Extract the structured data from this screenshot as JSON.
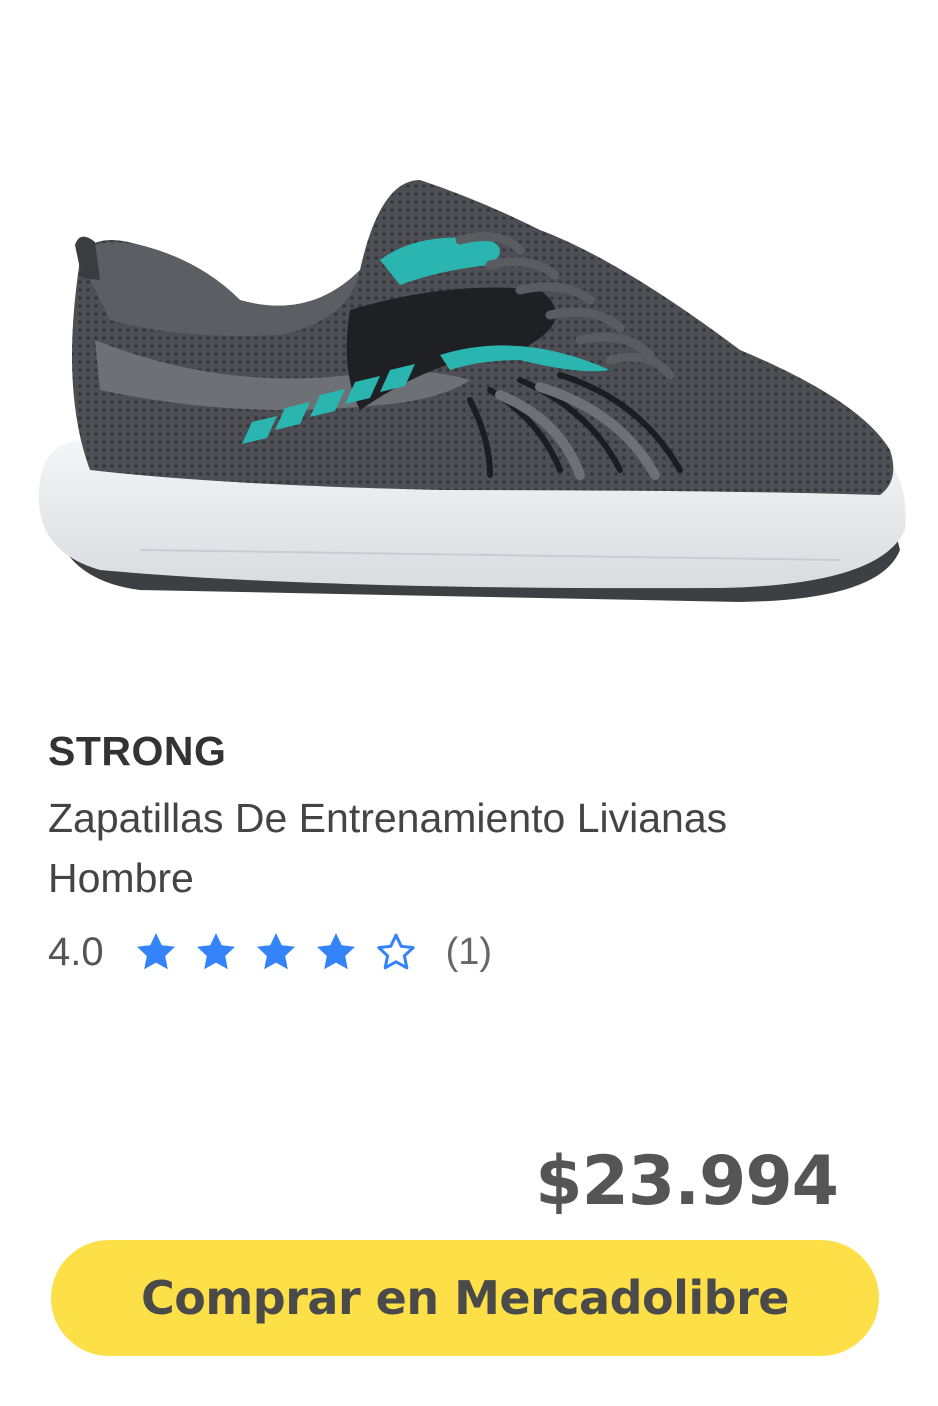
{
  "product": {
    "brand": "STRONG",
    "title": "Zapatillas De Entrenamiento Livianas Hombre",
    "image_alt": "sneaker-image",
    "rating": {
      "value": "4.0",
      "stars_filled": 4,
      "stars_total": 5,
      "count": "(1)"
    },
    "price": "$23.994"
  },
  "cta": {
    "label": "Comprar en Mercadolibre"
  },
  "colors": {
    "star": "#3483fa",
    "button_bg": "#fde047",
    "button_text": "#4a4a4a",
    "shoe_upper": "#4b4d52",
    "shoe_accent": "#2bb5b0",
    "sole": "#eef0f2"
  }
}
